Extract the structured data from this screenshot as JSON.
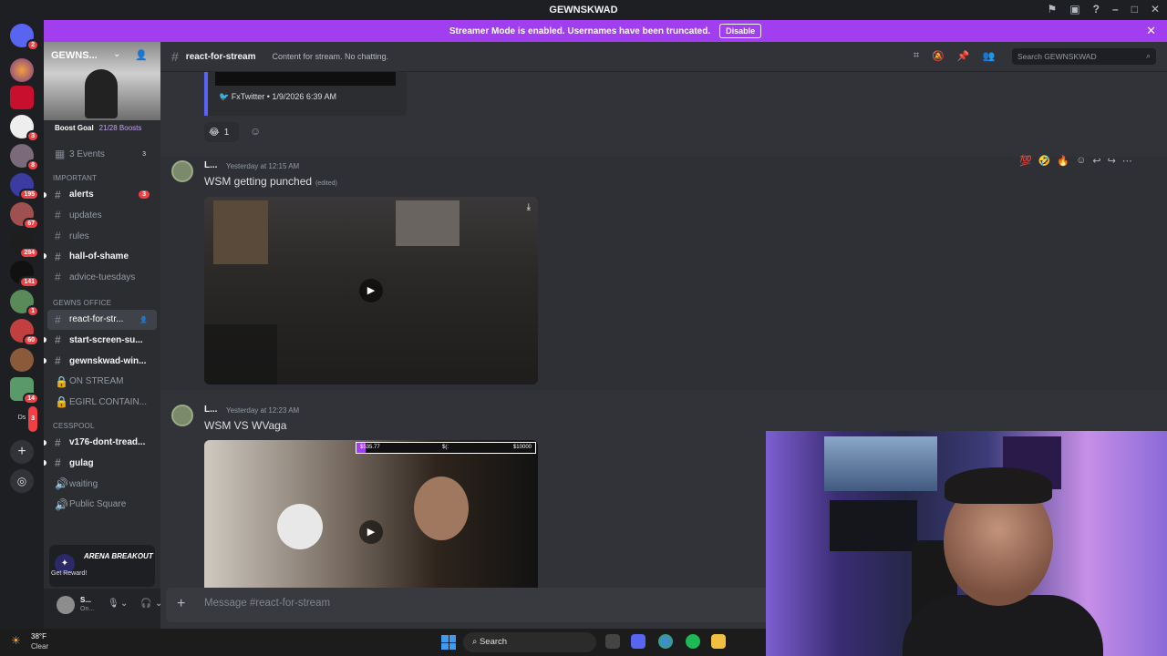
{
  "window": {
    "title": "GEWNSKWAD"
  },
  "banner": {
    "text": "Streamer Mode is enabled. Usernames have been truncated.",
    "disable_label": "Disable"
  },
  "servers": [
    {
      "badge": "2"
    },
    {
      "badge": ""
    },
    {
      "badge": ""
    },
    {
      "badge": "3"
    },
    {
      "badge": "8"
    },
    {
      "badge": "195"
    },
    {
      "badge": "67"
    },
    {
      "badge": "284"
    },
    {
      "badge": "141"
    },
    {
      "badge": "1"
    },
    {
      "badge": "60"
    },
    {
      "badge": ""
    },
    {
      "badge": "14"
    },
    {
      "badge": "3"
    }
  ],
  "server_labels": {
    "ds": "Ds"
  },
  "guild": {
    "name": "GEWNS...",
    "boost_label": "Boost Goal",
    "boost_count": "21/28 Boosts",
    "events_label": "3 Events",
    "events_count": "3"
  },
  "channel_groups": {
    "important": "IMPORTANT",
    "office": "GEWNS OFFICE",
    "cesspool": "CESSPOOL"
  },
  "channels": {
    "alerts": {
      "name": "alerts",
      "count": "3"
    },
    "updates": "updates",
    "rules": "rules",
    "hall": "hall-of-shame",
    "advice": "advice-tuesdays",
    "react": "react-for-str...",
    "start": "start-screen-su...",
    "gewnskwad": "gewnskwad-win...",
    "on_stream": "ON STREAM",
    "egirl": "EGIRL CONTAIN...",
    "v176": "v176-dont-tread...",
    "gulag": "gulag",
    "waiting": "waiting",
    "public": "Public Square"
  },
  "promo": {
    "title": "ARENA BREAKOUT",
    "subtitle": "Get Reward!"
  },
  "user": {
    "name": "S...",
    "status": "On..."
  },
  "channel_header": {
    "name": "react-for-stream",
    "topic": "Content for stream. No chatting.",
    "search_placeholder": "Search GEWNSKWAD"
  },
  "prev_embed": {
    "footer": "FxTwitter • 1/9/2026 6:39 AM",
    "reaction_emoji": "😂",
    "reaction_count": "1"
  },
  "messages": [
    {
      "author": "L...",
      "time": "Yesterday at 12:15 AM",
      "text": "WSM getting punched",
      "edited": "(edited)"
    },
    {
      "author": "L...",
      "time": "Yesterday at 12:23 AM",
      "text": "WSM VS WVaga",
      "edited": ""
    }
  ],
  "video2_overlay": {
    "left": "$535.77",
    "mid": "$(:",
    "right": "$10000"
  },
  "composer": {
    "placeholder": "Message #react-for-stream"
  },
  "taskbar": {
    "temp": "38°F",
    "weather": "Clear",
    "search": "Search"
  },
  "colors": {
    "accent": "#a13ef0",
    "blurple": "#5865f2",
    "notify": "#f23f43",
    "bg": "#313338"
  }
}
